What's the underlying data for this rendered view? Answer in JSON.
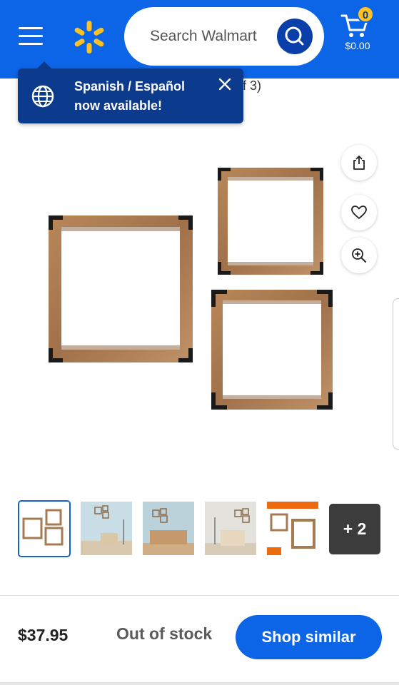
{
  "header": {
    "search_placeholder": "Search Walmart",
    "cart_count": "0",
    "cart_total": "$0.00",
    "brand_color": "#0c64e6",
    "spark_color": "#ffc220"
  },
  "tooltip": {
    "line1": "Spanish / Español",
    "line2": "now available!",
    "background": "#0c3a8c"
  },
  "product": {
    "title_fragment": "of 3)",
    "main_image_alt": "three wooden square shelves with black corner brackets"
  },
  "side_actions": [
    {
      "name": "share",
      "icon": "share-icon"
    },
    {
      "name": "favorite",
      "icon": "heart-icon"
    },
    {
      "name": "zoom",
      "icon": "zoom-in-icon"
    }
  ],
  "thumbnails": {
    "items": [
      "shelves-product",
      "room-scene-chair",
      "room-scene-sofa",
      "room-scene-armchair",
      "shelves-detail"
    ],
    "more_count": "+ 2"
  },
  "purchase": {
    "price": "$37.95",
    "status": "Out of stock",
    "cta_label": "Shop similar"
  }
}
